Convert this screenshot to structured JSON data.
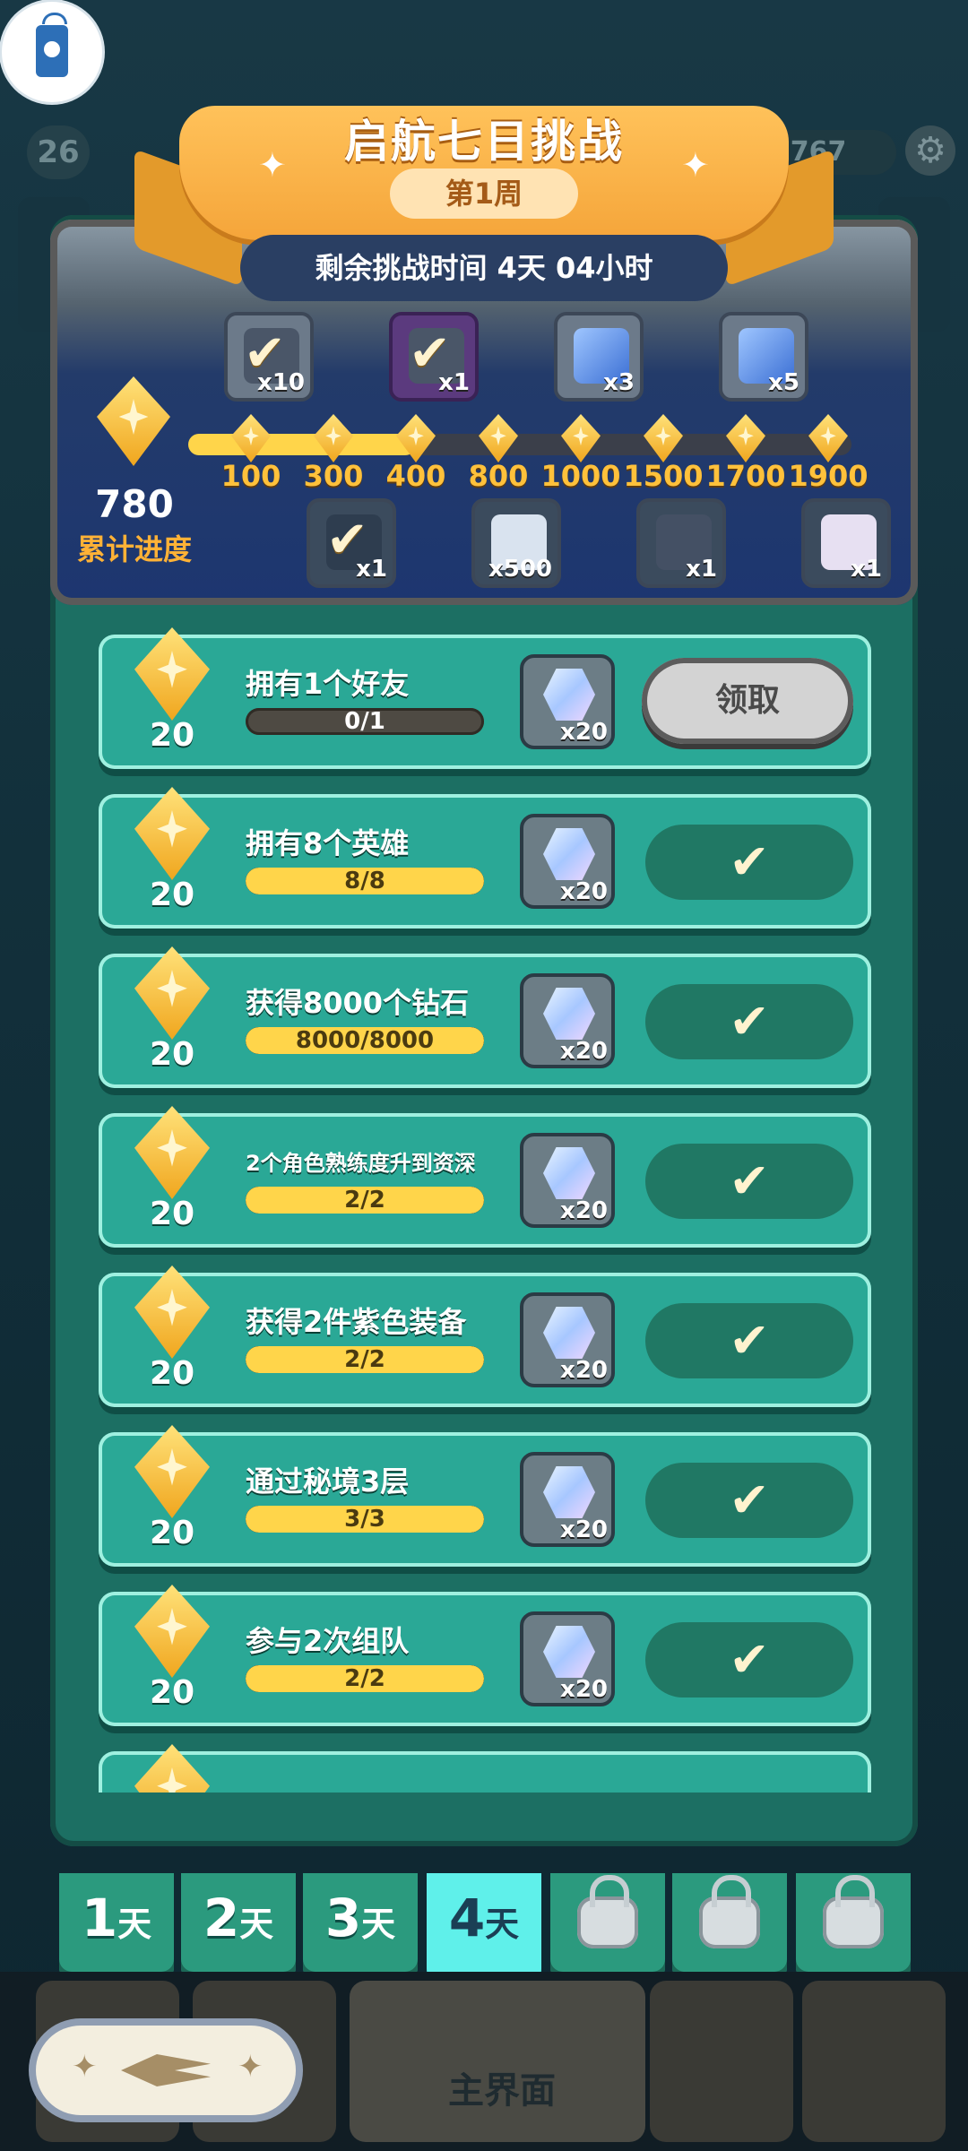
{
  "header": {
    "title": "启航七日挑战",
    "week": "第1周",
    "time_left": "剩余挑战时间 4天 04小时"
  },
  "background": {
    "level": "26",
    "coins": "32767",
    "settings_icon": "gear-icon"
  },
  "progress": {
    "total": "780",
    "label": "累计进度",
    "current_value": 780,
    "max_value": 1900,
    "milestones": [
      "100",
      "300",
      "400",
      "800",
      "1000",
      "1500",
      "1700",
      "1900"
    ],
    "top_rewards": [
      {
        "qty": "x10",
        "claimed": true
      },
      {
        "qty": "x1",
        "claimed": true
      },
      {
        "qty": "x3",
        "claimed": false
      },
      {
        "qty": "x5",
        "claimed": false
      }
    ],
    "bottom_rewards": [
      {
        "qty": "x1",
        "claimed": true
      },
      {
        "qty": "x500",
        "claimed": false
      },
      {
        "qty": "x1",
        "claimed": false
      },
      {
        "qty": "x1",
        "claimed": false
      }
    ]
  },
  "tasks": [
    {
      "points": "20",
      "name": "拥有1个好友",
      "progress": "0/1",
      "fraction": 0,
      "reward_qty": "x20",
      "status": "claim",
      "claim_label": "领取"
    },
    {
      "points": "20",
      "name": "拥有8个英雄",
      "progress": "8/8",
      "fraction": 1,
      "reward_qty": "x20",
      "status": "done"
    },
    {
      "points": "20",
      "name": "获得8000个钻石",
      "progress": "8000/8000",
      "fraction": 1,
      "reward_qty": "x20",
      "status": "done"
    },
    {
      "points": "20",
      "name": "2个角色熟练度升到资深",
      "progress": "2/2",
      "fraction": 1,
      "reward_qty": "x20",
      "status": "done"
    },
    {
      "points": "20",
      "name": "获得2件紫色装备",
      "progress": "2/2",
      "fraction": 1,
      "reward_qty": "x20",
      "status": "done"
    },
    {
      "points": "20",
      "name": "通过秘境3层",
      "progress": "3/3",
      "fraction": 1,
      "reward_qty": "x20",
      "status": "done"
    },
    {
      "points": "20",
      "name": "参与2次组队",
      "progress": "2/2",
      "fraction": 1,
      "reward_qty": "x20",
      "status": "done"
    }
  ],
  "days": [
    {
      "num": "1",
      "unit": "天",
      "locked": false,
      "active": false
    },
    {
      "num": "2",
      "unit": "天",
      "locked": false,
      "active": false
    },
    {
      "num": "3",
      "unit": "天",
      "locked": false,
      "active": false
    },
    {
      "num": "4",
      "unit": "天",
      "locked": false,
      "active": true
    },
    {
      "num": "",
      "unit": "",
      "locked": true,
      "active": false
    },
    {
      "num": "",
      "unit": "",
      "locked": true,
      "active": false
    },
    {
      "num": "",
      "unit": "",
      "locked": true,
      "active": false
    }
  ],
  "bottom_nav": {
    "main_label": "主界面"
  },
  "icons": {
    "check": "✔",
    "star": "✦"
  }
}
